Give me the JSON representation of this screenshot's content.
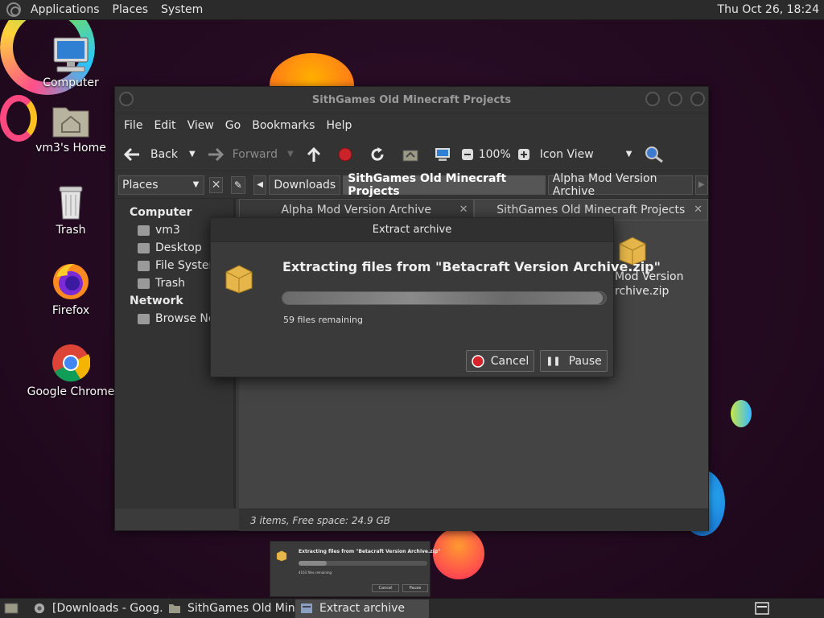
{
  "top_panel": {
    "menus": [
      "Applications",
      "Places",
      "System"
    ],
    "clock": "Thu Oct 26, 18:24"
  },
  "desktop_icons": [
    {
      "label": "Computer",
      "icon": "computer-icon"
    },
    {
      "label": "vm3's Home",
      "icon": "home-folder-icon"
    },
    {
      "label": "Trash",
      "icon": "trash-icon"
    },
    {
      "label": "Firefox",
      "icon": "firefox-icon"
    },
    {
      "label": "Google Chrome",
      "icon": "chrome-icon"
    }
  ],
  "file_manager": {
    "title": "SithGames Old Minecraft Projects",
    "menubar": [
      "File",
      "Edit",
      "View",
      "Go",
      "Bookmarks",
      "Help"
    ],
    "toolbar": {
      "back": "Back",
      "forward": "Forward",
      "zoom": "100%",
      "view_mode": "Icon View"
    },
    "places_combo": "Places",
    "breadcrumbs": [
      "Downloads",
      "SithGames Old Minecraft Projects",
      "Alpha Mod Version Archive"
    ],
    "sidebar": {
      "computer_header": "Computer",
      "computer_items": [
        "vm3",
        "Desktop",
        "File System",
        "Trash"
      ],
      "network_header": "Network",
      "network_items": [
        "Browse Net"
      ]
    },
    "tabs": [
      {
        "label": "Alpha Mod Version Archive"
      },
      {
        "label": "SithGames Old Minecraft Projects"
      }
    ],
    "visible_file": {
      "line1": "Mod Version",
      "line2": "rchive.zip"
    },
    "status": "3 items, Free space: 24.9 GB"
  },
  "dialog": {
    "title": "Extract archive",
    "heading": "Extracting files from \"Betacraft Version Archive.zip\"",
    "progress_fraction": 0.99,
    "remaining": "59 files remaining",
    "cancel": "Cancel",
    "pause": "Pause"
  },
  "thumbnail": {
    "heading": "Extracting files from \"Betacraft Version Archive.zip\"",
    "remaining": "4163 files remaining",
    "cancel": "Cancel",
    "pause": "Pause"
  },
  "taskbar": {
    "tasks": [
      {
        "label": "[Downloads - Goog...",
        "icon": "chrome-icon"
      },
      {
        "label": "SithGames Old Min...",
        "icon": "folder-icon"
      },
      {
        "label": "Extract archive",
        "icon": "archive-icon"
      }
    ]
  },
  "colors": {
    "desktop_bg": "#2a0d26",
    "panel_bg": "#2b2b2b",
    "window_bg": "#3b3b3b",
    "cancel_red": "#d5252a"
  }
}
